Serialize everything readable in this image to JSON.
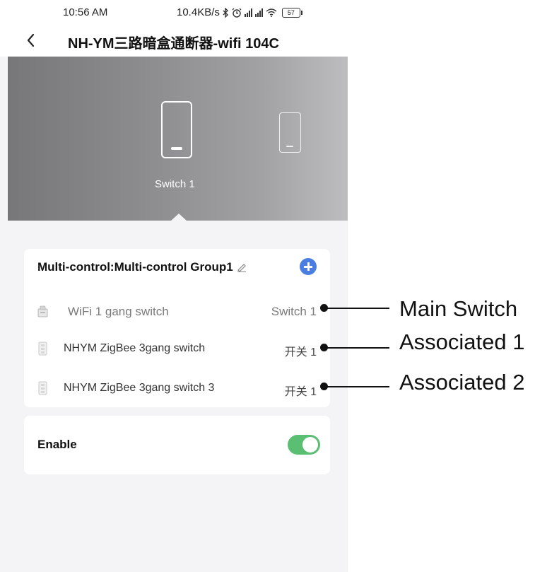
{
  "status_bar": {
    "time": "10:56 AM",
    "net_speed": "10.4KB/s",
    "battery": "57"
  },
  "nav": {
    "title": "NH-YM三路暗盒通断器-wifi 104C"
  },
  "hero": {
    "selected_switch_label": "Switch 1"
  },
  "group": {
    "title": "Multi-control:Multi-control Group1",
    "devices": [
      {
        "name": "WiFi 1 gang switch",
        "value": "Switch 1"
      },
      {
        "name": "NHYM ZigBee 3gang switch",
        "value": "开关 1"
      },
      {
        "name": "NHYM ZigBee 3gang switch 3",
        "value": "开关 1"
      }
    ]
  },
  "enable": {
    "label": "Enable",
    "on": true
  },
  "annotations": {
    "main": "Main Switch",
    "assoc1": "Associated 1",
    "assoc2": "Associated 2"
  },
  "colors": {
    "accent_blue": "#4a7ee0",
    "toggle_green": "#5bbf73"
  }
}
